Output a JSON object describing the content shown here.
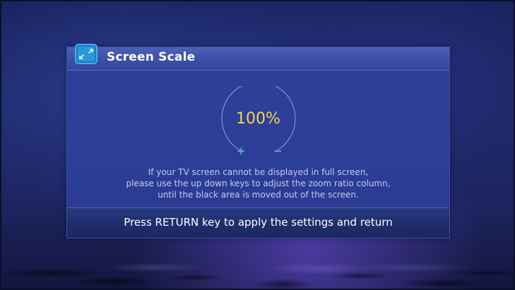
{
  "dialog": {
    "title": "Screen Scale",
    "icon": "screen-scale-icon",
    "zoom_value": "100%",
    "increase_symbol": "+",
    "decrease_symbol": "−",
    "message_lines": [
      "If your TV screen cannot be displayed in full screen,",
      "please use the up down keys to adjust the zoom ratio column,",
      "until the black area is moved out of the screen."
    ],
    "footer_text": "Press RETURN key to apply the settings and return"
  },
  "colors": {
    "accent_yellow": "#f2d84a",
    "icon_blue": "#2a9ad8",
    "sign_teal": "#5fb3c9"
  }
}
